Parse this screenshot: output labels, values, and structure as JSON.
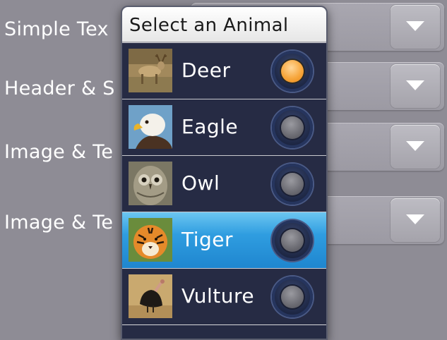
{
  "background": {
    "rows": [
      {
        "label": "Simple Tex",
        "dropdown_icon": "chevron-down-icon"
      },
      {
        "label": "Header & S",
        "dropdown_icon": "chevron-down-icon"
      },
      {
        "label": "Image & Te",
        "dropdown_icon": "chevron-down-icon"
      },
      {
        "label": "Image & Te",
        "dropdown_icon": "chevron-down-icon"
      }
    ]
  },
  "dialog": {
    "title": "Select an Animal",
    "options": [
      {
        "label": "Deer",
        "image": "deer-photo",
        "checked": true,
        "highlighted": false
      },
      {
        "label": "Eagle",
        "image": "eagle-photo",
        "checked": false,
        "highlighted": false
      },
      {
        "label": "Owl",
        "image": "owl-photo",
        "checked": false,
        "highlighted": false
      },
      {
        "label": "Tiger",
        "image": "tiger-photo",
        "checked": false,
        "highlighted": true
      },
      {
        "label": "Vulture",
        "image": "vulture-photo",
        "checked": false,
        "highlighted": false
      }
    ]
  },
  "colors": {
    "page_bg": "#8e8c95",
    "dialog_bg": "#262b44",
    "highlight": "#2f9de0",
    "radio_on": "#f7a73d",
    "radio_off": "#6f6f76"
  }
}
